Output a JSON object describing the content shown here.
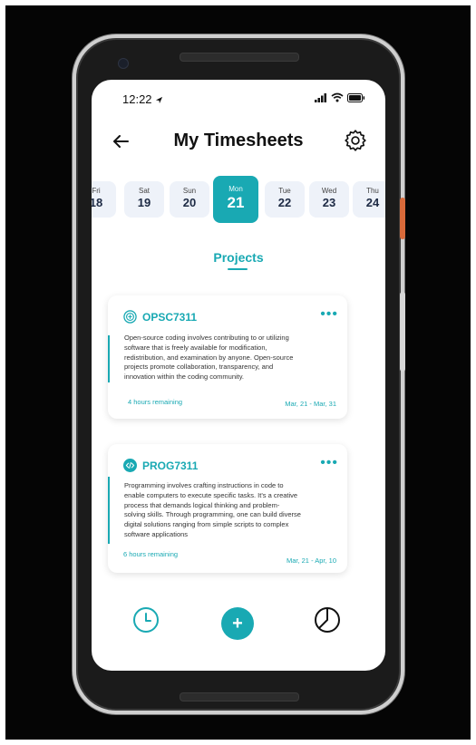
{
  "status": {
    "time": "12:22"
  },
  "header": {
    "title": "My Timesheets"
  },
  "days": [
    {
      "name": "Fri",
      "num": "18"
    },
    {
      "name": "Sat",
      "num": "19"
    },
    {
      "name": "Sun",
      "num": "20"
    },
    {
      "name": "Mon",
      "num": "21"
    },
    {
      "name": "Tue",
      "num": "22"
    },
    {
      "name": "Wed",
      "num": "23"
    },
    {
      "name": "Thu",
      "num": "24"
    }
  ],
  "selected_day": "Mon 21",
  "section": {
    "title": "Projects"
  },
  "projects": [
    {
      "code": "OPSC7311",
      "icon": "open-source-icon",
      "more": "•••",
      "desc": [
        "Open-source coding involves contributing to or utilizing",
        "software that is freely available for modification,",
        "redistribution, and examination by anyone. Open-source",
        "projects promote collaboration, transparency, and",
        "innovation within the coding community."
      ],
      "remaining": "4 hours remaining",
      "range": "Mar, 21 - Mar, 31"
    },
    {
      "code": "PROG7311",
      "icon": "code-icon",
      "more": "•••",
      "desc": [
        "Programming involves crafting instructions in code to",
        "enable computers to execute specific tasks. It's a creative",
        "process that demands logical thinking and problem-",
        "solving skills. Through programming, one can build diverse",
        "digital solutions ranging from simple scripts to complex",
        "software applications"
      ],
      "remaining": "6 hours remaining",
      "range": "Mar, 21 - Apr, 10"
    }
  ],
  "nav": {
    "add": "+"
  },
  "colors": {
    "accent": "#19a9b3",
    "chip": "#eef2f9"
  }
}
